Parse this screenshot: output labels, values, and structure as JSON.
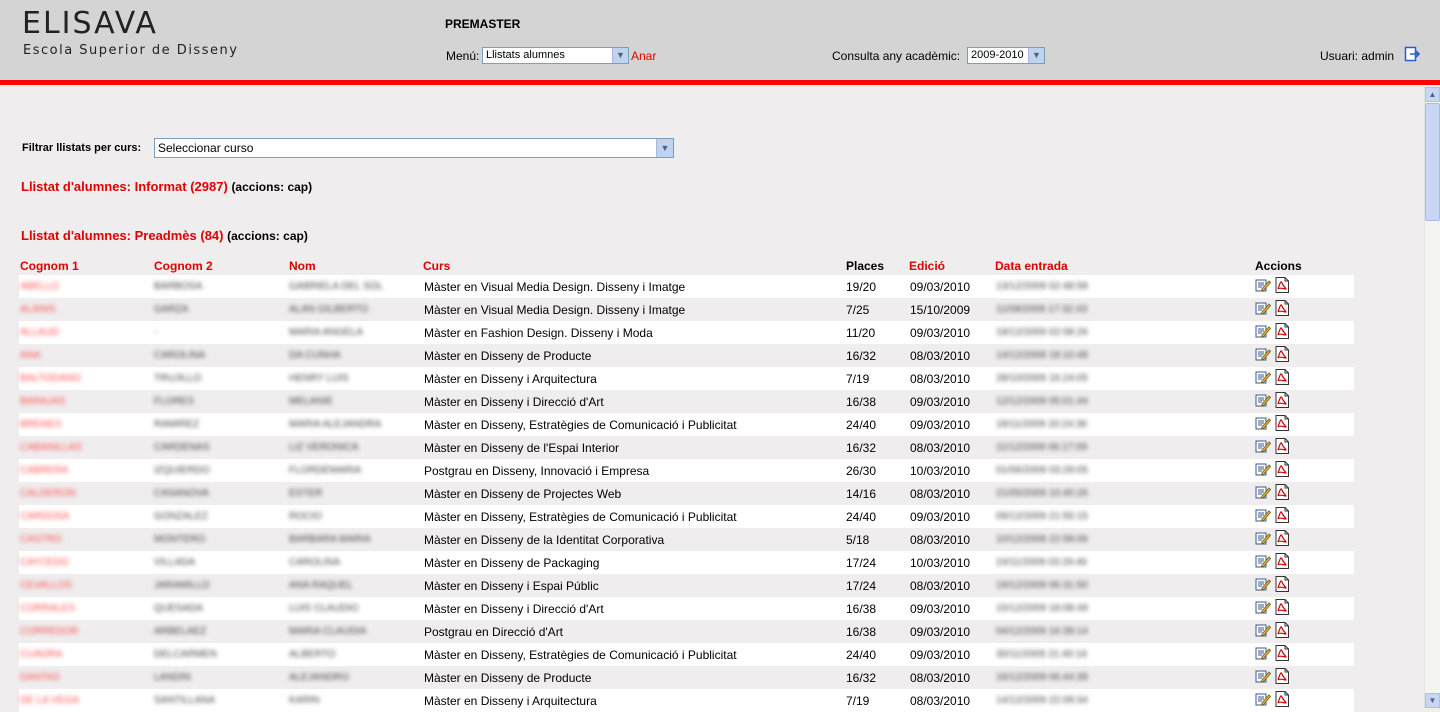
{
  "header": {
    "logo_title": "ELISAVA",
    "logo_subtitle": "Escola Superior de Disseny",
    "app_name": "PREMASTER",
    "menu_label": "Menú:",
    "menu_selected": "Llistats alumnes",
    "go_link": "Anar",
    "year_label": "Consulta any acadèmic:",
    "year_selected": "2009-2010",
    "user_label": "Usuari: admin"
  },
  "filter": {
    "label": "Filtrar llistats per curs:",
    "selected": "Seleccionar curso"
  },
  "sections": [
    {
      "title": "Llistat d'alumnes: Informat (2987)",
      "actions": "(accions: cap)"
    },
    {
      "title": "Llistat d'alumnes: Preadmès (84)",
      "actions": "(accions: cap)"
    }
  ],
  "table": {
    "headers": [
      "Cognom 1",
      "Cognom 2",
      "Nom",
      "Curs",
      "Places",
      "Edició",
      "Data entrada",
      "Accions"
    ],
    "rows": [
      {
        "cognom1": "ABELLO",
        "cognom2": "BARBOSA",
        "nom": "GABRIELA DEL SOL",
        "curs": "Màster en Visual Media Design. Disseny i Imatge",
        "places": "19/20",
        "edicio": "09/03/2010",
        "data": "13/12/2009 02:48:58"
      },
      {
        "cognom1": "ALANIS",
        "cognom2": "GARZA",
        "nom": "ALAN GILBERTO",
        "curs": "Màster en Visual Media Design. Disseny i Imatge",
        "places": "7/25",
        "edicio": "15/10/2009",
        "data": "11/08/2009 17:32:43"
      },
      {
        "cognom1": "ALLAUD",
        "cognom2": "-",
        "nom": "MARIA ANGELA",
        "curs": "Màster en Fashion Design. Disseny i Moda",
        "places": "11/20",
        "edicio": "09/03/2010",
        "data": "19/12/2009 02:08:26"
      },
      {
        "cognom1": "ANA",
        "cognom2": "CAROLINA",
        "nom": "DA CUNHA",
        "curs": "Màster en Disseny de Producte",
        "places": "16/32",
        "edicio": "08/03/2010",
        "data": "14/12/2009 18:10:48"
      },
      {
        "cognom1": "BALTODANO",
        "cognom2": "TRUJILLO",
        "nom": "HENRY LUIS",
        "curs": "Màster en Disseny i Arquitectura",
        "places": "7/19",
        "edicio": "08/03/2010",
        "data": "28/10/2009 16:24:05"
      },
      {
        "cognom1": "BARAJAS",
        "cognom2": "FLORES",
        "nom": "MELANIE",
        "curs": "Màster en Disseny i Direcció d'Art",
        "places": "16/38",
        "edicio": "09/03/2010",
        "data": "12/12/2009 05:01:44"
      },
      {
        "cognom1": "BRENES",
        "cognom2": "RAMIREZ",
        "nom": "MARIA ALEJANDRA",
        "curs": "Màster en Disseny, Estratègies de Comunicació i Publicitat",
        "places": "24/40",
        "edicio": "09/03/2010",
        "data": "18/11/2009 20:24:36"
      },
      {
        "cognom1": "CABANILLAS",
        "cognom2": "CARDENAS",
        "nom": "LIZ VERONICA",
        "curs": "Màster en Disseny de l'Espai Interior",
        "places": "16/32",
        "edicio": "08/03/2010",
        "data": "11/12/2009 06:17:09"
      },
      {
        "cognom1": "CABRERA",
        "cognom2": "IZQUIERDO",
        "nom": "FLORDEMARIA",
        "curs": "Postgrau en Disseny, Innovació i Empresa",
        "places": "26/30",
        "edicio": "10/03/2010",
        "data": "01/06/2009 03:29:05"
      },
      {
        "cognom1": "CALDERON",
        "cognom2": "CASANOVA",
        "nom": "ESTER",
        "curs": "Màster en Disseny de Projectes Web",
        "places": "14/16",
        "edicio": "08/03/2010",
        "data": "21/05/2009 10:40:26"
      },
      {
        "cognom1": "CARDOSA",
        "cognom2": "GONZALEZ",
        "nom": "ROCIO",
        "curs": "Màster en Disseny, Estratègies de Comunicació i Publicitat",
        "places": "24/40",
        "edicio": "09/03/2010",
        "data": "09/12/2009 21:55:15"
      },
      {
        "cognom1": "CASTRO",
        "cognom2": "MONTERO",
        "nom": "BARBARA MARIA",
        "curs": "Màster en Disseny de la Identitat Corporativa",
        "places": "5/18",
        "edicio": "08/03/2010",
        "data": "10/12/2009 22:58:06"
      },
      {
        "cognom1": "CAYCEDO",
        "cognom2": "VILLADA",
        "nom": "CAROLINA",
        "curs": "Màster en Disseny de Packaging",
        "places": "17/24",
        "edicio": "10/03/2010",
        "data": "24/11/2009 03:29:46"
      },
      {
        "cognom1": "CEVALLOS",
        "cognom2": "JARAMILLO",
        "nom": "ANA RAQUEL",
        "curs": "Màster en Disseny i Espai Públic",
        "places": "17/24",
        "edicio": "08/03/2010",
        "data": "19/12/2009 06:31:50"
      },
      {
        "cognom1": "CORRALES",
        "cognom2": "QUESADA",
        "nom": "LUIS CLAUDIO",
        "curs": "Màster en Disseny i Direcció d'Art",
        "places": "16/38",
        "edicio": "09/03/2010",
        "data": "15/12/2009 18:08:49"
      },
      {
        "cognom1": "CORREDOR",
        "cognom2": "ARBELAEZ",
        "nom": "MARIA CLAUDIA",
        "curs": "Postgrau en Direcció d'Art",
        "places": "16/38",
        "edicio": "09/03/2010",
        "data": "04/12/2009 16:39:14"
      },
      {
        "cognom1": "CUADRA",
        "cognom2": "DELCARMEN",
        "nom": "ALBERTO",
        "curs": "Màster en Disseny, Estratègies de Comunicació i Publicitat",
        "places": "24/40",
        "edicio": "09/03/2010",
        "data": "30/11/2009 21:40:16"
      },
      {
        "cognom1": "DANTAS",
        "cognom2": "LANDIN",
        "nom": "ALEJANDRO",
        "curs": "Màster en Disseny de Producte",
        "places": "16/32",
        "edicio": "08/03/2010",
        "data": "16/12/2009 06:44:39"
      },
      {
        "cognom1": "DE LA VEGA",
        "cognom2": "SANTILLANA",
        "nom": "KARIN",
        "curs": "Màster en Disseny i Arquitectura",
        "places": "7/19",
        "edicio": "08/03/2010",
        "data": "14/12/2009 22:09:34"
      }
    ]
  },
  "colors": {
    "accent_red": "#ff0000",
    "header_bg": "#d4d4d4",
    "page_bg": "#efedee"
  },
  "icons": {
    "logout": "logout-icon",
    "edit": "edit-icon",
    "pdf": "pdf-icon",
    "dropdown": "chevron-down-icon"
  }
}
